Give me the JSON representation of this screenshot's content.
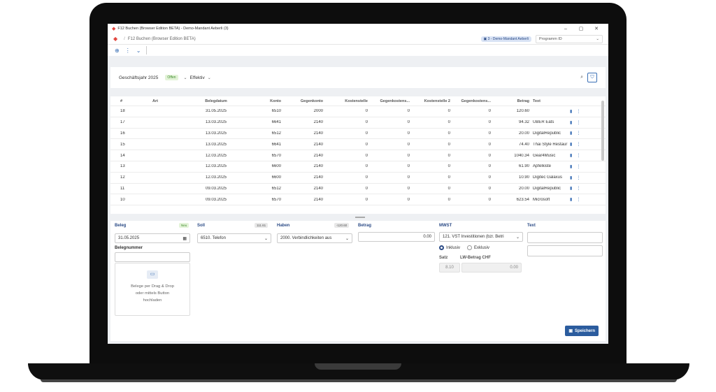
{
  "window": {
    "title": "F12 Buchen (Browser Edition BETA) - Demo-Mandant Aeberli (3)",
    "minimize": "–",
    "maximize": "▢",
    "close": "✕"
  },
  "nav": {
    "breadcrumb_sep": "/",
    "page": "F12 Buchen (Browser Edition BETA)",
    "mandant": "3 - Demo-Mandant Aeberli",
    "program_placeholder": "Programm ID"
  },
  "toolbar": {
    "add": "⊕",
    "more": "⋮",
    "dropdown": "⌄"
  },
  "filter": {
    "year": "Geschäftsjahr 2025",
    "status": "Offen",
    "mode": "Effektiv"
  },
  "table": {
    "headers": [
      "#",
      "Art",
      "Belegdatum",
      "Konto",
      "Gegenkonto",
      "Kostenstelle",
      "Gegenkostens...",
      "Kostenstelle 2",
      "Gegenkostens...",
      "Betrag",
      "Text"
    ],
    "rows": [
      [
        "18",
        "",
        "31.05.2025",
        "6510",
        "2000",
        "0",
        "0",
        "0",
        "0",
        "120.60",
        ""
      ],
      [
        "17",
        "",
        "13.03.2025",
        "6641",
        "2140",
        "0",
        "0",
        "0",
        "0",
        "94.32",
        "UBER Eats"
      ],
      [
        "16",
        "",
        "13.03.2025",
        "6512",
        "2140",
        "0",
        "0",
        "0",
        "0",
        "20.00",
        "DigitalRepublic"
      ],
      [
        "15",
        "",
        "13.03.2025",
        "6641",
        "2140",
        "0",
        "0",
        "0",
        "0",
        "74.40",
        "Thai Style Restaur"
      ],
      [
        "14",
        "",
        "12.03.2025",
        "6570",
        "2140",
        "0",
        "0",
        "0",
        "0",
        "1040.34",
        "Gear4Music"
      ],
      [
        "13",
        "",
        "12.03.2025",
        "6600",
        "2140",
        "0",
        "0",
        "0",
        "0",
        "61.90",
        "Apfelkiste"
      ],
      [
        "12",
        "",
        "12.03.2025",
        "6600",
        "2140",
        "0",
        "0",
        "0",
        "0",
        "10.90",
        "Digitec Galaxus"
      ],
      [
        "11",
        "",
        "09.03.2025",
        "6512",
        "2140",
        "0",
        "0",
        "0",
        "0",
        "20.00",
        "DigitalRepublic"
      ],
      [
        "10",
        "",
        "09.03.2025",
        "6570",
        "2140",
        "0",
        "0",
        "0",
        "0",
        "623.54",
        "Microsoft"
      ]
    ]
  },
  "form": {
    "beleg_label": "Beleg",
    "beleg_badge": "Neu",
    "date": "31.05.2025",
    "belegnummer_label": "Belegnummer",
    "dropzone_line1": "Belege per Drag & Drop",
    "dropzone_line2": "oder mittels Button",
    "dropzone_line3": "hochladen",
    "soll_label": "Soll",
    "soll_badge": "111.61",
    "soll_value": "6510. Telefon",
    "haben_label": "Haben",
    "haben_badge": "-120.60",
    "haben_value": "2000. Verbindlichkeiten aus",
    "betrag_label": "Betrag",
    "betrag_value": "0.00",
    "mwst_label": "MWST",
    "mwst_value": "121. VST Investitionen (bzr. Betri",
    "inklusiv": "Inklusiv",
    "exklusiv": "Exklusiv",
    "satz_label": "Satz",
    "satz_value": "8.10",
    "lw_label": "LW-Betrag CHF",
    "lw_value": "0.00",
    "text_label": "Text",
    "save": "Speichern"
  },
  "colors": {
    "accent": "#2b5c9e",
    "brand": "#e2463f"
  }
}
